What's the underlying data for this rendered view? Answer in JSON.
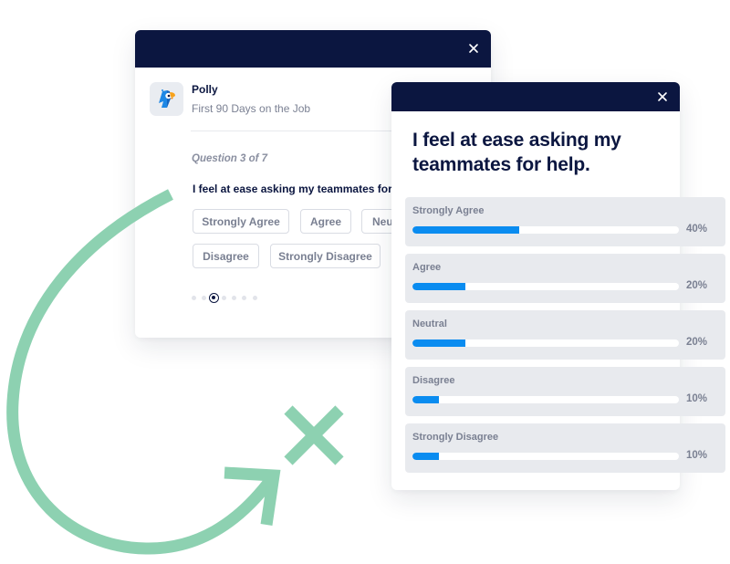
{
  "survey_card": {
    "close_icon": "close-icon",
    "app_icon": "polly-parrot-logo",
    "app_name": "Polly",
    "survey_name": "First 90 Days on the Job",
    "question_counter": "Question 3 of 7",
    "question_text": "I feel at ease asking my teammates for help.",
    "options": [
      "Strongly Agree",
      "Agree",
      "Neutral",
      "Disagree",
      "Strongly Disagree"
    ],
    "progress": {
      "current": 3,
      "total": 7
    }
  },
  "results_card": {
    "close_icon": "close-icon",
    "title": "I feel at ease asking my teammates for help.",
    "results": [
      {
        "label": "Strongly Agree",
        "percent": 40,
        "percent_label": "40%"
      },
      {
        "label": "Agree",
        "percent": 20,
        "percent_label": "20%"
      },
      {
        "label": "Neutral",
        "percent": 20,
        "percent_label": "20%"
      },
      {
        "label": "Disagree",
        "percent": 10,
        "percent_label": "10%"
      },
      {
        "label": "Strongly Disagree",
        "percent": 10,
        "percent_label": "10%"
      }
    ]
  },
  "colors": {
    "header_navy": "#0b1640",
    "bar_blue": "#0a8cf0",
    "card_gray": "#e8eaee",
    "decor_green": "#8dd1b1"
  },
  "decoration": {
    "arrow_icon": "curved-arrow-icon",
    "x_icon": "x-mark-icon"
  }
}
